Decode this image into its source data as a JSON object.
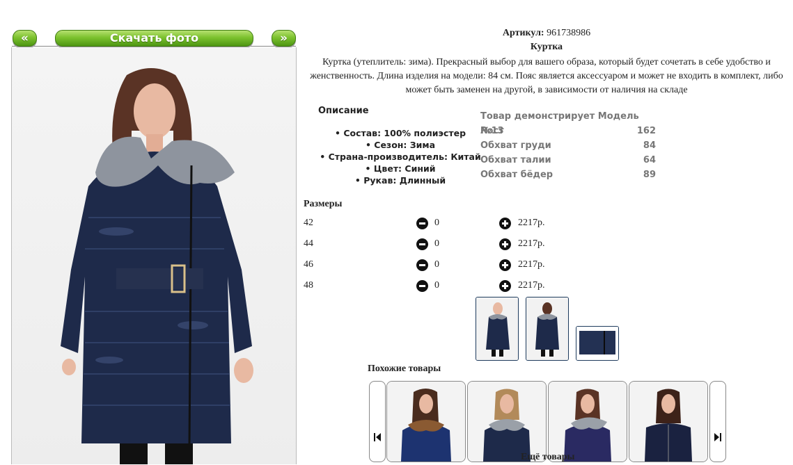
{
  "gallery": {
    "prev_label": "«",
    "download_label": "Скачать фото",
    "next_label": "»"
  },
  "product": {
    "sku_label": "Артикул:",
    "sku_value": "961738986",
    "name": "Куртка",
    "description": "Куртка (утеплитель: зима). Прекрасный выбор для вашего образа, который будет сочетать в себе удобство и женственность. Длина изделия на модели: 84 см. Пояс является аксессуаром и может не входить в комплект, либо может быть заменен на другой, в зависимости от наличия на складе"
  },
  "details": {
    "title": "Описание",
    "features": [
      "Состав: 100% полиэстер",
      "Сезон: Зима",
      "Страна-производитель: Китай",
      "Цвет: Синий",
      "Рукав: Длинный"
    ]
  },
  "model": {
    "title": "Товар демонстрирует Модель №13",
    "rows": [
      {
        "label": "Рост",
        "value": "162"
      },
      {
        "label": "Обхват груди",
        "value": "84"
      },
      {
        "label": "Обхват талии",
        "value": "64"
      },
      {
        "label": "Обхват бёдер",
        "value": "89"
      }
    ]
  },
  "sizes": {
    "title": "Размеры",
    "rows": [
      {
        "size": "42",
        "qty": "0",
        "price": "2217р."
      },
      {
        "size": "44",
        "qty": "0",
        "price": "2217р."
      },
      {
        "size": "46",
        "qty": "0",
        "price": "2217р."
      },
      {
        "size": "48",
        "qty": "0",
        "price": "2217р."
      }
    ]
  },
  "similar": {
    "title": "Похожие товары",
    "more_label": "Ещё товары"
  },
  "colors": {
    "jacket": "#1e2a4a",
    "accent_green": "#5aa51a"
  }
}
